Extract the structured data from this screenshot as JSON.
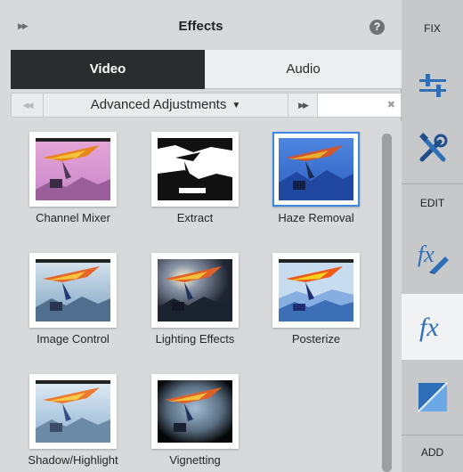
{
  "header": {
    "title": "Effects"
  },
  "tabs": [
    {
      "label": "Video",
      "active": true
    },
    {
      "label": "Audio",
      "active": false
    }
  ],
  "toolbar": {
    "category": "Advanced Adjustments",
    "search_value": ""
  },
  "effects": [
    {
      "label": "Channel Mixer"
    },
    {
      "label": "Extract"
    },
    {
      "label": "Haze Removal",
      "selected": true
    },
    {
      "label": "Image Control"
    },
    {
      "label": "Lighting Effects"
    },
    {
      "label": "Posterize"
    },
    {
      "label": "Shadow/Highlight"
    },
    {
      "label": "Vignetting"
    }
  ],
  "sidebar": {
    "fix_label": "FIX",
    "edit_label": "EDIT",
    "add_label": "ADD",
    "buttons": [
      {
        "icon": "adjust-sliders-icon"
      },
      {
        "icon": "tools-icon"
      },
      {
        "icon": "fx-edit-icon"
      },
      {
        "icon": "fx-icon",
        "active": true
      },
      {
        "icon": "transitions-icon"
      }
    ]
  },
  "colors": {
    "accent": "#3a88e0",
    "active_tab": "#2b2c2e",
    "icon_blue": "#2f6fb8"
  }
}
